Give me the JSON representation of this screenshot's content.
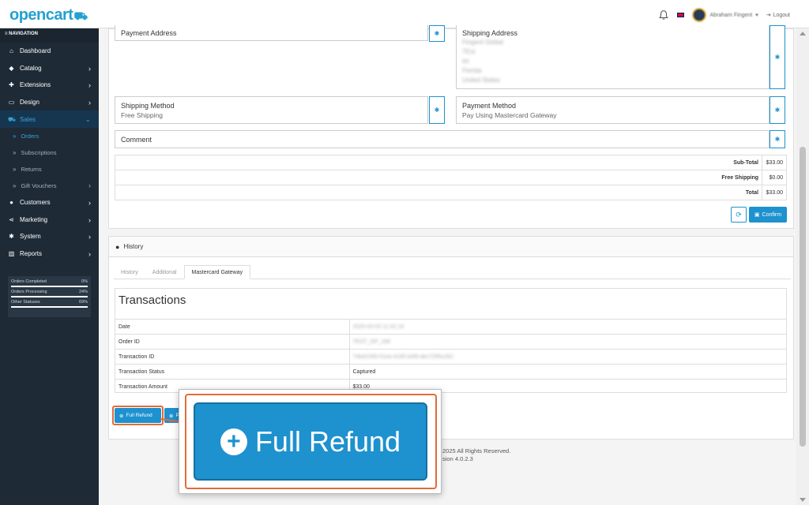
{
  "header": {
    "logo_text": "opencart",
    "user_name": "Abraham Fingent",
    "logout_label": "Logout"
  },
  "sidebar": {
    "nav_title": "NAVIGATION",
    "items": [
      {
        "label": "Dashboard",
        "icon": "home-icon"
      },
      {
        "label": "Catalog",
        "icon": "tag-icon"
      },
      {
        "label": "Extensions",
        "icon": "puzzle-icon"
      },
      {
        "label": "Design",
        "icon": "monitor-icon"
      },
      {
        "label": "Sales",
        "icon": "cart-icon"
      },
      {
        "label": "Customers",
        "icon": "user-icon"
      },
      {
        "label": "Marketing",
        "icon": "share-icon"
      },
      {
        "label": "System",
        "icon": "gear-icon"
      },
      {
        "label": "Reports",
        "icon": "bar-chart-icon"
      }
    ],
    "sales_sub": [
      "Orders",
      "Subscriptions",
      "Returns",
      "Gift Vouchers"
    ],
    "stats": [
      {
        "label": "Orders Completed",
        "value": "0%"
      },
      {
        "label": "Orders Processing",
        "value": "24%"
      },
      {
        "label": "Other Statuses",
        "value": "69%"
      }
    ]
  },
  "order": {
    "payment_address_label": "Payment Address",
    "shipping_address_label": "Shipping Address",
    "shipping_address_lines": [
      "Fingent Global",
      "TEst",
      "txt",
      "Florida",
      "United States"
    ],
    "shipping_method_label": "Shipping Method",
    "shipping_method_value": "Free Shipping",
    "payment_method_label": "Payment Method",
    "payment_method_value": "Pay Using Mastercard Gateway",
    "comment_label": "Comment",
    "totals": [
      {
        "label": "Sub-Total",
        "value": "$33.00"
      },
      {
        "label": "Free Shipping",
        "value": "$0.00"
      },
      {
        "label": "Total",
        "value": "$33.00"
      }
    ],
    "confirm_label": "Confirm"
  },
  "history": {
    "title": "History",
    "tabs": [
      "History",
      "Additional",
      "Mastercard Gateway"
    ],
    "transactions_title": "Transactions",
    "rows": [
      {
        "key": "Date",
        "value": "2025-03-03 11:42:19",
        "blurred": true
      },
      {
        "key": "Order ID",
        "value": "TEST_OP_186",
        "blurred": true
      },
      {
        "key": "Transaction ID",
        "value": "74bd2269-51ea-4185-b4f9-dec72ff5c262",
        "blurred": true
      },
      {
        "key": "Transaction Status",
        "value": "Captured",
        "blurred": false
      },
      {
        "key": "Transaction Amount",
        "value": "$33.00",
        "blurred": false
      }
    ],
    "full_refund_label": "Full Refund",
    "partial_refund_label": "P"
  },
  "footer": {
    "copyright": "2025 All Rights Reserved.",
    "version": "sion 4.0.2.3"
  },
  "callout": {
    "label": "Full Refund"
  },
  "colors": {
    "accent": "#1e91cf",
    "highlight": "#e06c3a",
    "sidebar_bg": "#1e2a36"
  }
}
